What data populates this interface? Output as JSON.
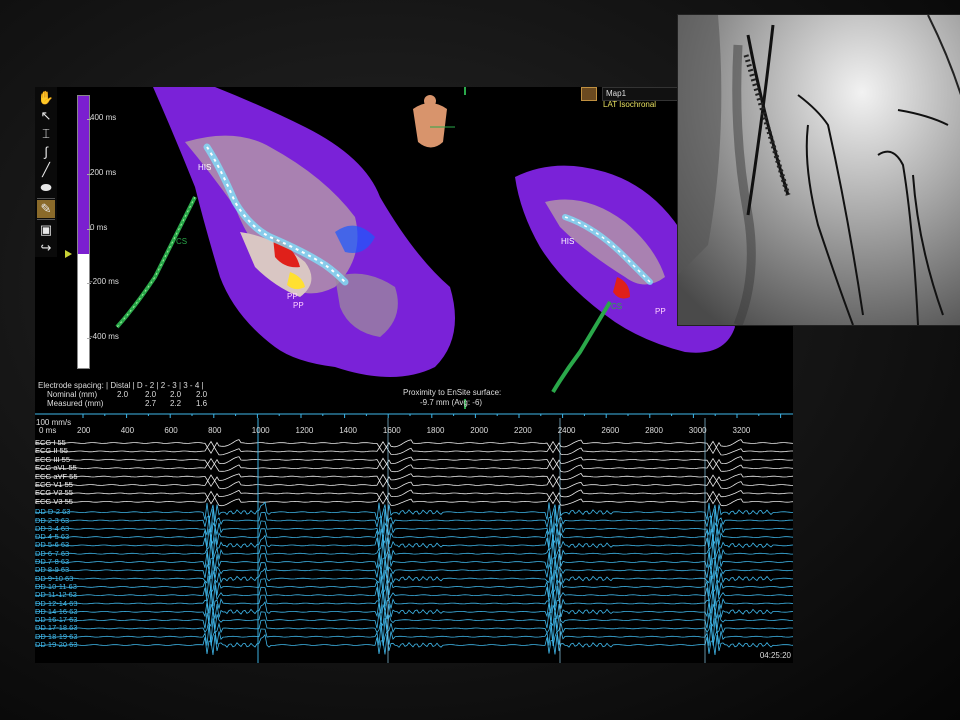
{
  "toolbar": {
    "tools": [
      "hand-icon",
      "pointer-icon",
      "caliper-icon",
      "curve-icon",
      "pen-icon",
      "ellipse-icon",
      "pencil-icon",
      "shadow-icon",
      "catheter-icon"
    ]
  },
  "colorbar": {
    "ticks": [
      "400 ms",
      "200 ms",
      "0 ms",
      "-200 ms",
      "-400 ms"
    ],
    "colors": {
      "purple": "#7b1fd0",
      "white": "#ffffff",
      "red": "#e0201a",
      "green": "#2aa84a",
      "blue": "#1a5aff"
    }
  },
  "map_panel": {
    "name": "Map1",
    "type": "LAT Isochronal"
  },
  "spacing": {
    "header": "Electrode spacing: | Distal | D - 2 | 2 - 3 | 3 - 4 |",
    "nominal_label": "Nominal (mm)",
    "nominal": [
      "2.0",
      "2.0",
      "2.0",
      "2.0"
    ],
    "measured_label": "Measured (mm)",
    "measured": [
      "2.7",
      "2.2",
      "1.6"
    ]
  },
  "proximity": {
    "title": "Proximity to EnSite surface:",
    "value": "-9.7 mm (Avg: -6)"
  },
  "map_labels": {
    "his_left": "HIS",
    "his_right": "HIS",
    "pp1": "PP",
    "pp2": "PP",
    "pp3": "PP",
    "cs_left": "CS",
    "cs_right": "CS"
  },
  "timeline": {
    "speed": "100 mm/s",
    "zero": "0 ms",
    "ticks": [
      "200",
      "400",
      "600",
      "800",
      "1000",
      "1200",
      "1400",
      "1600",
      "1800",
      "2000",
      "2200",
      "2400",
      "2600",
      "2800",
      "3000",
      "3200"
    ]
  },
  "ecg_channels": [
    "ECG I 55",
    "ECG II 55",
    "ECG III 55",
    "ECG aVL 55",
    "ECG aVF 55",
    "ECG V1 55",
    "ECG V2 55",
    "ECG V3 55"
  ],
  "ep_channels": [
    "DD   D-2 63",
    "DD   2-3 63",
    "DD   3-4 63",
    "DD   4-5 63",
    "DD   5-6 63",
    "DD   6-7 63",
    "DD   7-8 63",
    "DD   8-9 63",
    "DD   9-10 63",
    "DD   10-11 63",
    "DD   11-12 63",
    "DD   12-14 63",
    "DD   14-16 63",
    "DD   16-17 63",
    "DD   17-18 63",
    "DD   18-19 63",
    "DD   19-20 63"
  ],
  "clock": "04:25:20"
}
